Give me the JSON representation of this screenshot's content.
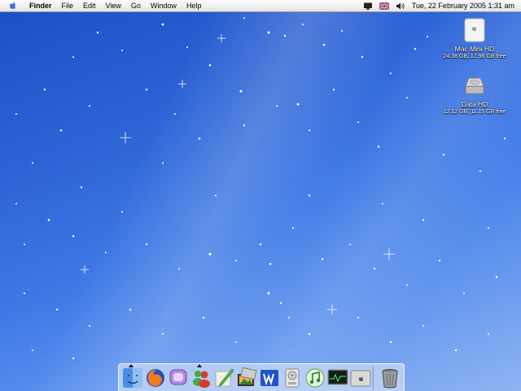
{
  "menubar": {
    "app_name": "Finder",
    "menus": [
      "File",
      "Edit",
      "View",
      "Go",
      "Window",
      "Help"
    ],
    "clock": "Tue, 22 February 2005  1:31 am",
    "status_icons": [
      "display-icon",
      "uk-flag-icon",
      "volume-icon"
    ]
  },
  "desktop_icons": [
    {
      "name": "Mac Mini HD",
      "info": "24.38 GB, 17.96 GB free",
      "icon": "drive-icon"
    },
    {
      "name": "Data HD",
      "info": "12.12 GB, 11.15 GB free",
      "icon": "hard-disk-icon"
    }
  ],
  "dock": {
    "items": [
      {
        "name": "Finder",
        "icon": "finder-icon",
        "running": true
      },
      {
        "name": "Firefox",
        "icon": "firefox-icon",
        "running": false
      },
      {
        "name": "Adium",
        "icon": "chat-icon",
        "running": false
      },
      {
        "name": "Messenger",
        "icon": "messenger-icon",
        "running": true
      },
      {
        "name": "Editor",
        "icon": "pen-icon",
        "running": false
      },
      {
        "name": "iPhoto",
        "icon": "iphoto-icon",
        "running": false
      },
      {
        "name": "Word",
        "icon": "word-icon",
        "running": false
      },
      {
        "name": "Disk Utility",
        "icon": "disk-icon",
        "running": false
      },
      {
        "name": "iTunes",
        "icon": "itunes-icon",
        "running": false
      },
      {
        "name": "Activity Monitor",
        "icon": "monitor-icon",
        "running": false
      },
      {
        "name": "System Preferences",
        "icon": "apple-prefs-icon",
        "running": false
      }
    ],
    "trash": {
      "name": "Trash",
      "icon": "trash-icon"
    }
  }
}
